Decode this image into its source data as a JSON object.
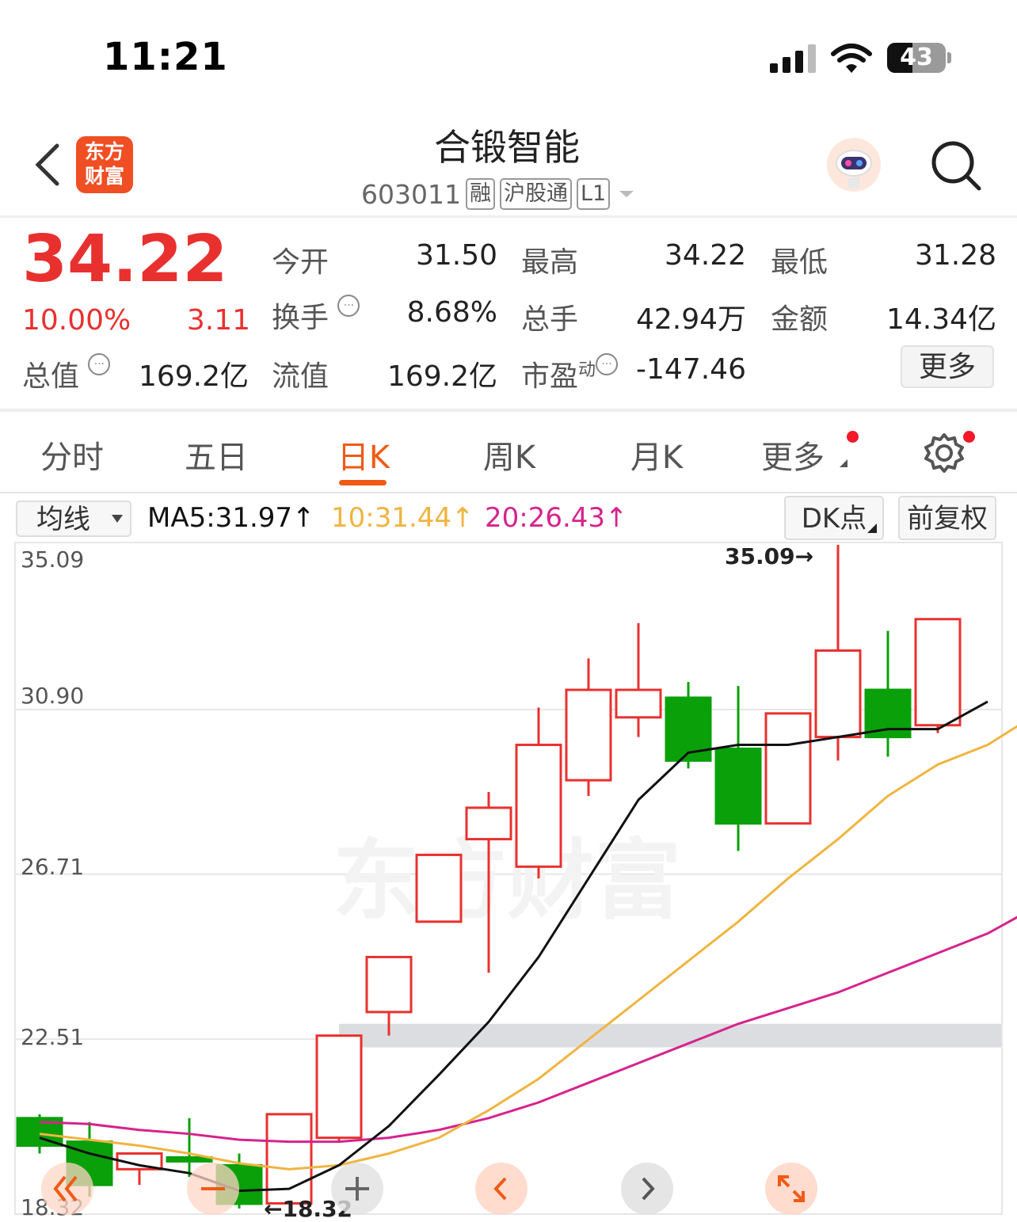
{
  "status": {
    "time": "11:21",
    "battery": "43",
    "battery_level": 0.43
  },
  "header": {
    "logo_line1": "东方",
    "logo_line2": "财富",
    "stock_name": "合锻智能",
    "code": "603011",
    "tags": [
      "融",
      "沪股通",
      "L1"
    ]
  },
  "quote": {
    "price": "34.22",
    "change_pct": "10.00%",
    "change": "3.11",
    "rows": [
      [
        {
          "label": "今开",
          "value": "31.50",
          "red": true
        },
        {
          "label": "最高",
          "value": "34.22",
          "red": true
        },
        {
          "label": "最低",
          "value": "31.28",
          "red": true
        }
      ],
      [
        {
          "label": "换手",
          "value": "8.68%"
        },
        {
          "label": "总手",
          "value": "42.94万"
        },
        {
          "label": "金额",
          "value": "14.34亿"
        }
      ],
      [
        {
          "label": "流值",
          "value": "169.2亿"
        },
        {
          "label": "市盈",
          "sup": "动",
          "value": "-147.46"
        }
      ]
    ],
    "total_value_label": "总值",
    "total_value": "169.2亿",
    "more_label": "更多"
  },
  "tabs": [
    "分时",
    "五日",
    "日K",
    "周K",
    "月K",
    "更多"
  ],
  "active_tab": 2,
  "indicator": {
    "select_label": "均线",
    "ma5": "MA5:31.97↑",
    "ma10": "10:31.44↑",
    "ma20": "20:26.43↑",
    "dk_label": "DK点",
    "adj_label": "前复权"
  },
  "colors": {
    "up": "#e8312f",
    "down": "#0aa00a",
    "ma5": "#111111",
    "ma10": "#f0b440",
    "ma20": "#d6238c",
    "accent": "#f05a15"
  },
  "chart_data": {
    "type": "candlestick",
    "y_ticks": [
      "35.09",
      "30.90",
      "26.71",
      "22.51",
      "18.32"
    ],
    "ylim": [
      18.32,
      35.09
    ],
    "max_label": "35.09→",
    "min_label": "←18.32",
    "watermark": "东方财富",
    "candles": [
      {
        "o": 20.5,
        "c": 19.8,
        "h": 20.6,
        "l": 19.6
      },
      {
        "o": 19.9,
        "c": 18.8,
        "h": 20.4,
        "l": 18.5
      },
      {
        "o": 19.2,
        "c": 19.6,
        "h": 19.6,
        "l": 18.8
      },
      {
        "o": 19.5,
        "c": 19.4,
        "h": 20.5,
        "l": 19.0
      },
      {
        "o": 19.3,
        "c": 18.32,
        "h": 19.6,
        "l": 18.2
      },
      {
        "o": 18.33,
        "c": 20.6,
        "h": 20.6,
        "l": 18.32
      },
      {
        "o": 20.0,
        "c": 22.6,
        "h": 22.6,
        "l": 19.9
      },
      {
        "o": 23.2,
        "c": 24.6,
        "h": 24.6,
        "l": 22.6
      },
      {
        "o": 25.5,
        "c": 27.2,
        "h": 27.2,
        "l": 25.5
      },
      {
        "o": 27.6,
        "c": 28.4,
        "h": 28.8,
        "l": 24.2
      },
      {
        "o": 26.9,
        "c": 30.0,
        "h": 30.95,
        "l": 26.6
      },
      {
        "o": 29.1,
        "c": 31.4,
        "h": 32.2,
        "l": 28.7
      },
      {
        "o": 30.7,
        "c": 31.4,
        "h": 33.1,
        "l": 30.2
      },
      {
        "o": 31.2,
        "c": 29.6,
        "h": 31.6,
        "l": 29.4
      },
      {
        "o": 29.9,
        "c": 28.0,
        "h": 31.5,
        "l": 27.3
      },
      {
        "o": 28.0,
        "c": 30.8,
        "h": 30.8,
        "l": 28.0
      },
      {
        "o": 30.2,
        "c": 32.4,
        "h": 35.09,
        "l": 29.6
      },
      {
        "o": 31.4,
        "c": 30.2,
        "h": 32.9,
        "l": 29.7
      },
      {
        "o": 30.5,
        "c": 33.2,
        "h": 33.2,
        "l": 30.3
      }
    ],
    "ma5": [
      20.0,
      19.6,
      19.3,
      19.1,
      18.65,
      18.7,
      19.3,
      20.3,
      21.6,
      22.95,
      24.6,
      26.6,
      28.6,
      29.8,
      30.0,
      30.0,
      30.2,
      30.4,
      30.4,
      31.1
    ],
    "ma10": [
      20.1,
      19.95,
      19.8,
      19.6,
      19.35,
      19.2,
      19.3,
      19.6,
      20.0,
      20.7,
      21.5,
      22.5,
      23.5,
      24.5,
      25.5,
      26.6,
      27.6,
      28.7,
      29.5,
      30.0,
      30.8
    ],
    "ma20": [
      20.4,
      20.35,
      20.2,
      20.1,
      19.95,
      19.9,
      19.9,
      20.0,
      20.2,
      20.5,
      20.9,
      21.4,
      21.9,
      22.4,
      22.9,
      23.3,
      23.7,
      24.2,
      24.7,
      25.2,
      25.9
    ],
    "support_band": [
      22.3,
      22.9
    ]
  }
}
